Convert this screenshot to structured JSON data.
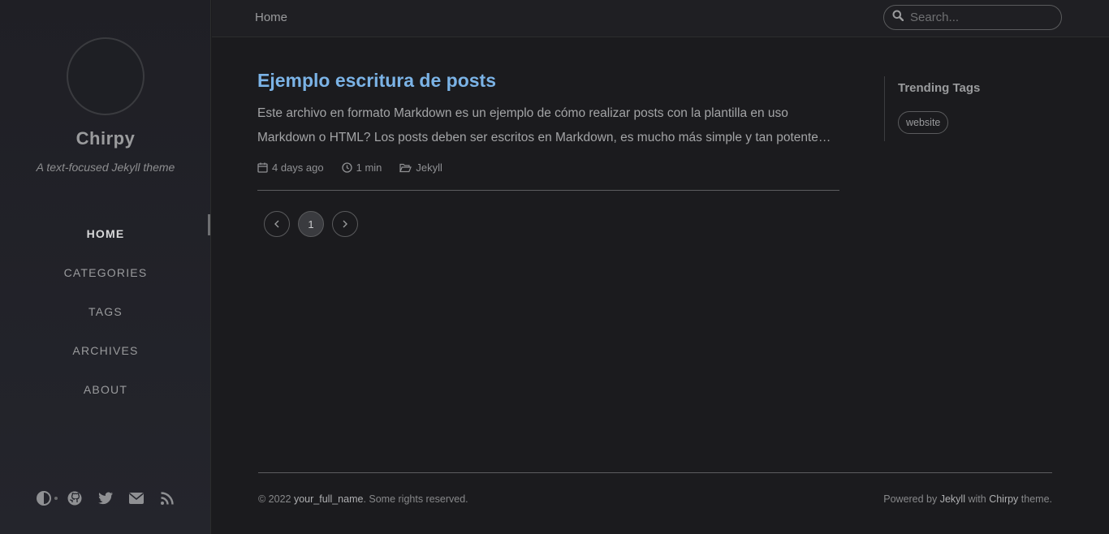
{
  "sidebar": {
    "site_title": "Chirpy",
    "site_subtitle": "A text-focused Jekyll theme",
    "nav": [
      {
        "label": "HOME",
        "active": true
      },
      {
        "label": "CATEGORIES",
        "active": false
      },
      {
        "label": "TAGS",
        "active": false
      },
      {
        "label": "ARCHIVES",
        "active": false
      },
      {
        "label": "ABOUT",
        "active": false
      }
    ],
    "bottom_icons": [
      "theme-toggle-icon",
      "github-icon",
      "twitter-icon",
      "email-icon",
      "rss-icon"
    ]
  },
  "topbar": {
    "breadcrumb": "Home",
    "search_placeholder": "Search..."
  },
  "post": {
    "title": "Ejemplo escritura de posts",
    "excerpt": "Este archivo en formato Markdown es un ejemplo de cómo realizar posts con la plantilla en uso Markdown o HTML? Los posts deben ser escritos en Markdown, es mucho más simple y tan potente…",
    "date": "4 days ago",
    "read_time": "1 min",
    "category": "Jekyll"
  },
  "pagination": {
    "current": "1"
  },
  "panel": {
    "heading": "Trending Tags",
    "tags": [
      "website"
    ]
  },
  "footer": {
    "copyright_prefix": "© 2022 ",
    "author": "your_full_name",
    "rights": ". Some rights reserved.",
    "powered_prefix": "Powered by ",
    "powered_jekyll": "Jekyll",
    "powered_with": " with ",
    "powered_chirpy": "Chirpy",
    "powered_suffix": " theme."
  },
  "colors": {
    "background": "#1b1b1e",
    "link": "#7bb3e6"
  }
}
